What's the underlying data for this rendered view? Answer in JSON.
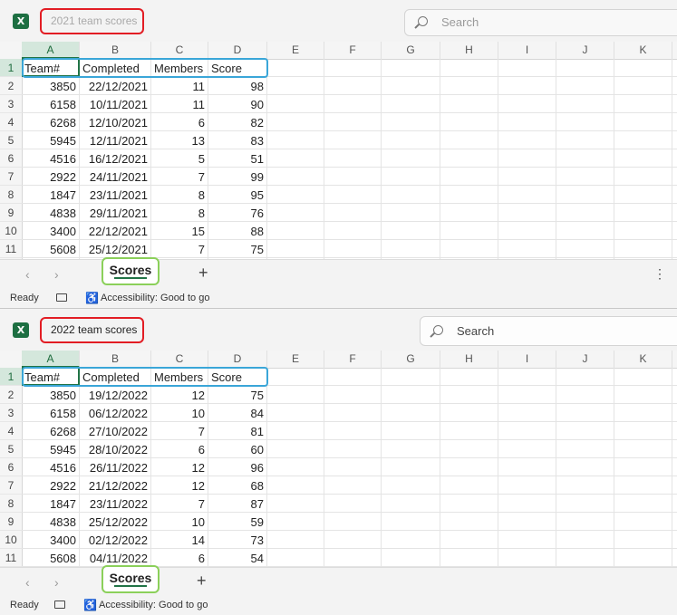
{
  "app": {
    "icon_name": "excel-icon",
    "accent": "#217346"
  },
  "windows": [
    {
      "title": "2021 team scores",
      "search_placeholder": "Search",
      "columns": [
        "A",
        "B",
        "C",
        "D",
        "E",
        "F",
        "G",
        "H",
        "I",
        "J",
        "K"
      ],
      "row_numbers": [
        "1",
        "2",
        "3",
        "4",
        "5",
        "6",
        "7",
        "8",
        "9",
        "10",
        "11"
      ],
      "headers": [
        "Team#",
        "Completed",
        "Members",
        "Score"
      ],
      "rows": [
        [
          "3850",
          "22/12/2021",
          "11",
          "98"
        ],
        [
          "6158",
          "10/11/2021",
          "11",
          "90"
        ],
        [
          "6268",
          "12/10/2021",
          "6",
          "82"
        ],
        [
          "5945",
          "12/11/2021",
          "13",
          "83"
        ],
        [
          "4516",
          "16/12/2021",
          "5",
          "51"
        ],
        [
          "2922",
          "24/11/2021",
          "7",
          "99"
        ],
        [
          "1847",
          "23/11/2021",
          "8",
          "95"
        ],
        [
          "4838",
          "29/11/2021",
          "8",
          "76"
        ],
        [
          "3400",
          "22/12/2021",
          "15",
          "88"
        ],
        [
          "5608",
          "25/12/2021",
          "7",
          "75"
        ]
      ],
      "sheet_tab": "Scores",
      "add_sheet": "+",
      "status": {
        "ready": "Ready",
        "accessibility": "Accessibility: Good to go"
      }
    },
    {
      "title": "2022 team scores",
      "search_placeholder": "Search",
      "columns": [
        "A",
        "B",
        "C",
        "D",
        "E",
        "F",
        "G",
        "H",
        "I",
        "J",
        "K"
      ],
      "row_numbers": [
        "1",
        "2",
        "3",
        "4",
        "5",
        "6",
        "7",
        "8",
        "9",
        "10",
        "11"
      ],
      "headers": [
        "Team#",
        "Completed",
        "Members",
        "Score"
      ],
      "rows": [
        [
          "3850",
          "19/12/2022",
          "12",
          "75"
        ],
        [
          "6158",
          "06/12/2022",
          "10",
          "84"
        ],
        [
          "6268",
          "27/10/2022",
          "7",
          "81"
        ],
        [
          "5945",
          "28/10/2022",
          "6",
          "60"
        ],
        [
          "4516",
          "26/11/2022",
          "12",
          "96"
        ],
        [
          "2922",
          "21/12/2022",
          "12",
          "68"
        ],
        [
          "1847",
          "23/11/2022",
          "7",
          "87"
        ],
        [
          "4838",
          "25/12/2022",
          "10",
          "59"
        ],
        [
          "3400",
          "02/12/2022",
          "14",
          "73"
        ],
        [
          "5608",
          "04/11/2022",
          "6",
          "54"
        ]
      ],
      "sheet_tab": "Scores",
      "add_sheet": "+",
      "status": {
        "ready": "Ready",
        "accessibility": "Accessibility: Good to go"
      }
    }
  ],
  "annotation_colors": {
    "title_outline": "#e21d24",
    "header_outline": "#3aa6d8",
    "tab_outline": "#8bd05a"
  }
}
